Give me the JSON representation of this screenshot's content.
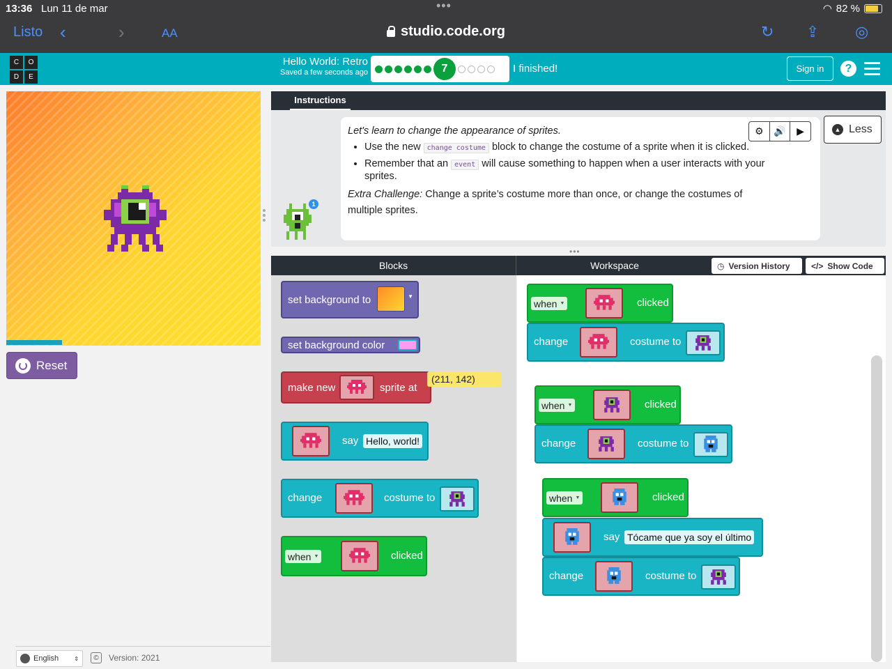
{
  "ios_status": {
    "time": "13:36",
    "date": "Lun 11 de mar",
    "battery": "82 %"
  },
  "safari": {
    "done_label": "Listo",
    "text_size_label": "AA",
    "url": "studio.code.org"
  },
  "header": {
    "logo_letters": [
      "C",
      "O",
      "D",
      "E"
    ],
    "lesson_title": "Hello World: Retro",
    "save_status": "Saved a few seconds ago",
    "current_level": "7",
    "levels_done_before": 6,
    "levels_after": 4,
    "finished_label": "I finished!",
    "sign_in_label": "Sign in",
    "help_label": "?"
  },
  "stage": {
    "reset_label": "Reset",
    "progress": 0.22
  },
  "footer": {
    "language": "English",
    "copyright_symbol": "©",
    "version": "Version: 2021"
  },
  "instructions": {
    "tab_label": "Instructions",
    "lead": "Let's learn to change the appearance of sprites.",
    "bullet1_pre": "Use the new ",
    "bullet1_code": "change costume",
    "bullet1_post": " block to change the costume of a sprite when it is clicked.",
    "bullet2_pre": "Remember that an ",
    "bullet2_code": "event",
    "bullet2_post": " will cause something to happen when a user interacts with your sprites.",
    "extra_label": "Extra Challenge:",
    "extra_text": " Change a sprite’s costume more than once, or change the costumes of multiple sprites.",
    "less_label": "Less",
    "badge_count": "1"
  },
  "editor": {
    "blocks_title": "Blocks",
    "workspace_title": "Workspace",
    "version_history_label": "Version History",
    "show_code_label": "Show Code"
  },
  "toolbox_blocks": {
    "set_background_to": "set background to",
    "set_background_color": "set background color",
    "make_new": "make new",
    "sprite_at": "sprite at",
    "coords": "(211, 142)",
    "say": "say",
    "hello_world": "Hello, world!",
    "change": "change",
    "costume_to": "costume to",
    "when": "when",
    "clicked": "clicked"
  },
  "workspace_blocks": {
    "when": "when",
    "clicked": "clicked",
    "change": "change",
    "costume_to": "costume to",
    "say": "say",
    "say_text": "Tócame que ya soy el último"
  },
  "colors": {
    "codeorg_teal": "#00adbc",
    "reset_purple": "#7e5ca2",
    "event_green": "#13be3e",
    "sprite_red": "#c6404e",
    "action_teal": "#1ab5c4",
    "world_purple": "#6f68b0"
  }
}
